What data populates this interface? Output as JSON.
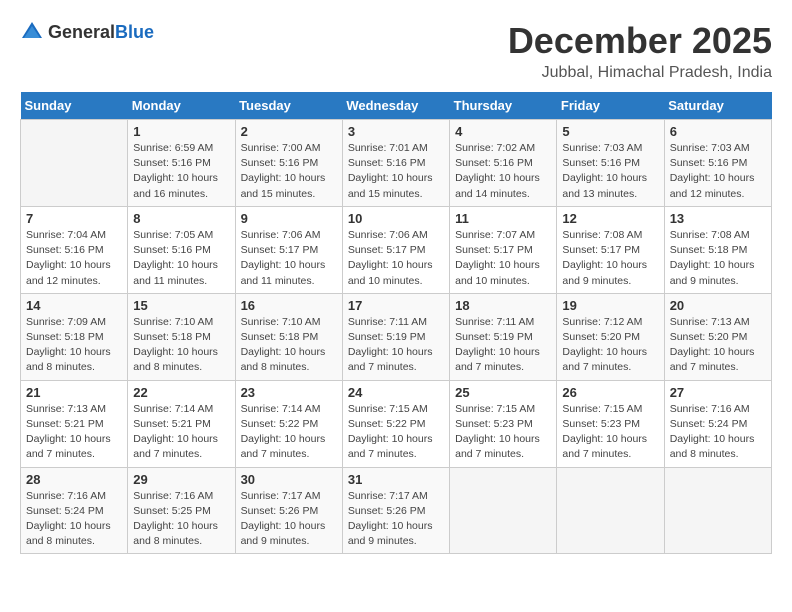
{
  "header": {
    "logo_general": "General",
    "logo_blue": "Blue",
    "title": "December 2025",
    "location": "Jubbal, Himachal Pradesh, India"
  },
  "calendar": {
    "weekdays": [
      "Sunday",
      "Monday",
      "Tuesday",
      "Wednesday",
      "Thursday",
      "Friday",
      "Saturday"
    ],
    "weeks": [
      [
        {
          "day": "",
          "info": ""
        },
        {
          "day": "1",
          "info": "Sunrise: 6:59 AM\nSunset: 5:16 PM\nDaylight: 10 hours\nand 16 minutes."
        },
        {
          "day": "2",
          "info": "Sunrise: 7:00 AM\nSunset: 5:16 PM\nDaylight: 10 hours\nand 15 minutes."
        },
        {
          "day": "3",
          "info": "Sunrise: 7:01 AM\nSunset: 5:16 PM\nDaylight: 10 hours\nand 15 minutes."
        },
        {
          "day": "4",
          "info": "Sunrise: 7:02 AM\nSunset: 5:16 PM\nDaylight: 10 hours\nand 14 minutes."
        },
        {
          "day": "5",
          "info": "Sunrise: 7:03 AM\nSunset: 5:16 PM\nDaylight: 10 hours\nand 13 minutes."
        },
        {
          "day": "6",
          "info": "Sunrise: 7:03 AM\nSunset: 5:16 PM\nDaylight: 10 hours\nand 12 minutes."
        }
      ],
      [
        {
          "day": "7",
          "info": "Sunrise: 7:04 AM\nSunset: 5:16 PM\nDaylight: 10 hours\nand 12 minutes."
        },
        {
          "day": "8",
          "info": "Sunrise: 7:05 AM\nSunset: 5:16 PM\nDaylight: 10 hours\nand 11 minutes."
        },
        {
          "day": "9",
          "info": "Sunrise: 7:06 AM\nSunset: 5:17 PM\nDaylight: 10 hours\nand 11 minutes."
        },
        {
          "day": "10",
          "info": "Sunrise: 7:06 AM\nSunset: 5:17 PM\nDaylight: 10 hours\nand 10 minutes."
        },
        {
          "day": "11",
          "info": "Sunrise: 7:07 AM\nSunset: 5:17 PM\nDaylight: 10 hours\nand 10 minutes."
        },
        {
          "day": "12",
          "info": "Sunrise: 7:08 AM\nSunset: 5:17 PM\nDaylight: 10 hours\nand 9 minutes."
        },
        {
          "day": "13",
          "info": "Sunrise: 7:08 AM\nSunset: 5:18 PM\nDaylight: 10 hours\nand 9 minutes."
        }
      ],
      [
        {
          "day": "14",
          "info": "Sunrise: 7:09 AM\nSunset: 5:18 PM\nDaylight: 10 hours\nand 8 minutes."
        },
        {
          "day": "15",
          "info": "Sunrise: 7:10 AM\nSunset: 5:18 PM\nDaylight: 10 hours\nand 8 minutes."
        },
        {
          "day": "16",
          "info": "Sunrise: 7:10 AM\nSunset: 5:18 PM\nDaylight: 10 hours\nand 8 minutes."
        },
        {
          "day": "17",
          "info": "Sunrise: 7:11 AM\nSunset: 5:19 PM\nDaylight: 10 hours\nand 7 minutes."
        },
        {
          "day": "18",
          "info": "Sunrise: 7:11 AM\nSunset: 5:19 PM\nDaylight: 10 hours\nand 7 minutes."
        },
        {
          "day": "19",
          "info": "Sunrise: 7:12 AM\nSunset: 5:20 PM\nDaylight: 10 hours\nand 7 minutes."
        },
        {
          "day": "20",
          "info": "Sunrise: 7:13 AM\nSunset: 5:20 PM\nDaylight: 10 hours\nand 7 minutes."
        }
      ],
      [
        {
          "day": "21",
          "info": "Sunrise: 7:13 AM\nSunset: 5:21 PM\nDaylight: 10 hours\nand 7 minutes."
        },
        {
          "day": "22",
          "info": "Sunrise: 7:14 AM\nSunset: 5:21 PM\nDaylight: 10 hours\nand 7 minutes."
        },
        {
          "day": "23",
          "info": "Sunrise: 7:14 AM\nSunset: 5:22 PM\nDaylight: 10 hours\nand 7 minutes."
        },
        {
          "day": "24",
          "info": "Sunrise: 7:15 AM\nSunset: 5:22 PM\nDaylight: 10 hours\nand 7 minutes."
        },
        {
          "day": "25",
          "info": "Sunrise: 7:15 AM\nSunset: 5:23 PM\nDaylight: 10 hours\nand 7 minutes."
        },
        {
          "day": "26",
          "info": "Sunrise: 7:15 AM\nSunset: 5:23 PM\nDaylight: 10 hours\nand 7 minutes."
        },
        {
          "day": "27",
          "info": "Sunrise: 7:16 AM\nSunset: 5:24 PM\nDaylight: 10 hours\nand 8 minutes."
        }
      ],
      [
        {
          "day": "28",
          "info": "Sunrise: 7:16 AM\nSunset: 5:24 PM\nDaylight: 10 hours\nand 8 minutes."
        },
        {
          "day": "29",
          "info": "Sunrise: 7:16 AM\nSunset: 5:25 PM\nDaylight: 10 hours\nand 8 minutes."
        },
        {
          "day": "30",
          "info": "Sunrise: 7:17 AM\nSunset: 5:26 PM\nDaylight: 10 hours\nand 9 minutes."
        },
        {
          "day": "31",
          "info": "Sunrise: 7:17 AM\nSunset: 5:26 PM\nDaylight: 10 hours\nand 9 minutes."
        },
        {
          "day": "",
          "info": ""
        },
        {
          "day": "",
          "info": ""
        },
        {
          "day": "",
          "info": ""
        }
      ]
    ]
  }
}
